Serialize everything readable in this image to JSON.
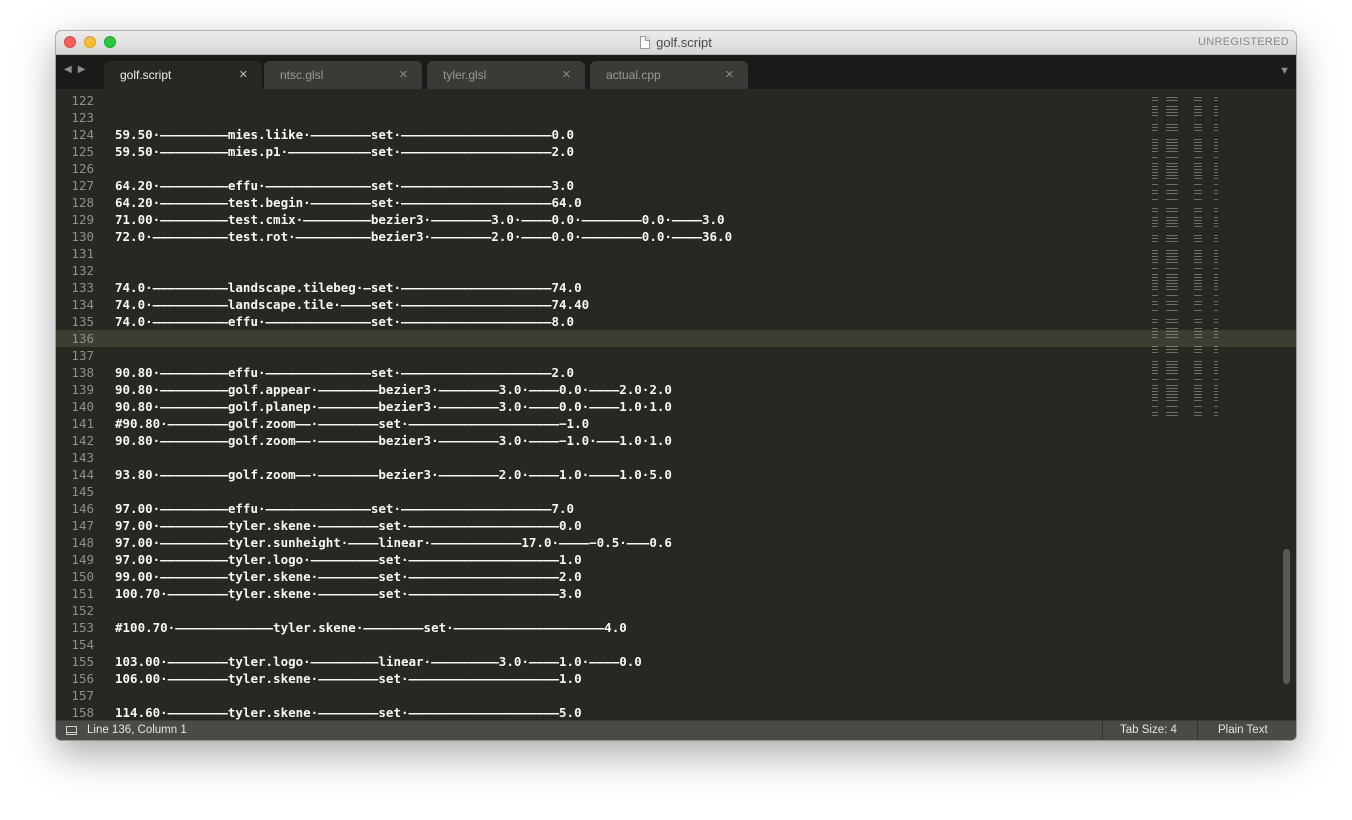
{
  "window": {
    "title": "golf.script",
    "registration": "UNREGISTERED"
  },
  "tabs": [
    {
      "label": "golf.script",
      "active": true
    },
    {
      "label": "ntsc.glsl",
      "active": false
    },
    {
      "label": "tyler.glsl",
      "active": false
    },
    {
      "label": "actual.cpp",
      "active": false
    }
  ],
  "editor": {
    "current_line": 136,
    "lines": [
      {
        "n": "122",
        "text": ""
      },
      {
        "n": "123",
        "text": ""
      },
      {
        "n": "124",
        "text": "59.50·—————————mies.liike·————————set·————————————————————0.0"
      },
      {
        "n": "125",
        "text": "59.50·—————————mies.p1·———————————set·————————————————————2.0"
      },
      {
        "n": "126",
        "text": ""
      },
      {
        "n": "127",
        "text": "64.20·—————————effu·——————————————set·————————————————————3.0"
      },
      {
        "n": "128",
        "text": "64.20·—————————test.begin·————————set·————————————————————64.0"
      },
      {
        "n": "129",
        "text": "71.00·—————————test.cmix·—————————bezier3·————————3.0·————0.0·————————0.0·————3.0"
      },
      {
        "n": "130",
        "text": "72.0·——————————test.rot·——————————bezier3·————————2.0·————0.0·————————0.0·————36.0"
      },
      {
        "n": "131",
        "text": ""
      },
      {
        "n": "132",
        "text": ""
      },
      {
        "n": "133",
        "text": "74.0·——————————landscape.tilebeg·—set·————————————————————74.0"
      },
      {
        "n": "134",
        "text": "74.0·——————————landscape.tile·————set·————————————————————74.40"
      },
      {
        "n": "135",
        "text": "74.0·——————————effu·——————————————set·————————————————————8.0"
      },
      {
        "n": "136",
        "text": ""
      },
      {
        "n": "137",
        "text": ""
      },
      {
        "n": "138",
        "text": "90.80·—————————effu·——————————————set·————————————————————2.0"
      },
      {
        "n": "139",
        "text": "90.80·—————————golf.appear·————————bezier3·————————3.0·————0.0·————2.0·2.0"
      },
      {
        "n": "140",
        "text": "90.80·—————————golf.planep·————————bezier3·————————3.0·————0.0·————1.0·1.0"
      },
      {
        "n": "141",
        "text": "#90.80·————————golf.zoom——·————————set·————————————————————−1.0"
      },
      {
        "n": "142",
        "text": "90.80·—————————golf.zoom——·————————bezier3·————————3.0·————−1.0·———1.0·1.0"
      },
      {
        "n": "143",
        "text": ""
      },
      {
        "n": "144",
        "text": "93.80·—————————golf.zoom——·————————bezier3·————————2.0·————1.0·————1.0·5.0"
      },
      {
        "n": "145",
        "text": ""
      },
      {
        "n": "146",
        "text": "97.00·—————————effu·——————————————set·————————————————————7.0"
      },
      {
        "n": "147",
        "text": "97.00·—————————tyler.skene·————————set·————————————————————0.0"
      },
      {
        "n": "148",
        "text": "97.00·—————————tyler.sunheight·————linear·————————————17.0·————−0.5·———0.6"
      },
      {
        "n": "149",
        "text": "97.00·—————————tyler.logo·—————————set·————————————————————1.0"
      },
      {
        "n": "150",
        "text": "99.00·—————————tyler.skene·————————set·————————————————————2.0"
      },
      {
        "n": "151",
        "text": "100.70·————————tyler.skene·————————set·————————————————————3.0"
      },
      {
        "n": "152",
        "text": ""
      },
      {
        "n": "153",
        "text": "#100.70·—————————————tyler.skene·————————set·————————————————————4.0"
      },
      {
        "n": "154",
        "text": ""
      },
      {
        "n": "155",
        "text": "103.00·————————tyler.logo·—————————linear·—————————3.0·————1.0·————0.0"
      },
      {
        "n": "156",
        "text": "106.00·————————tyler.skene·————————set·————————————————————1.0"
      },
      {
        "n": "157",
        "text": ""
      },
      {
        "n": "158",
        "text": "114.60·————————tyler.skene·————————set·————————————————————5.0"
      }
    ]
  },
  "status": {
    "position": "Line 136, Column 1",
    "tab_size": "Tab Size: 4",
    "syntax": "Plain Text"
  },
  "colors": {
    "background": "#272822",
    "text": "#f8f8f2",
    "gutter_text": "#90908a",
    "current_line": "#3e3d32"
  },
  "icons": {
    "nav_back": "chevron-left-icon",
    "nav_forward": "chevron-right-icon",
    "tab_close": "close-icon",
    "tab_dropdown": "chevron-down-icon",
    "status_panel": "panel-icon"
  }
}
